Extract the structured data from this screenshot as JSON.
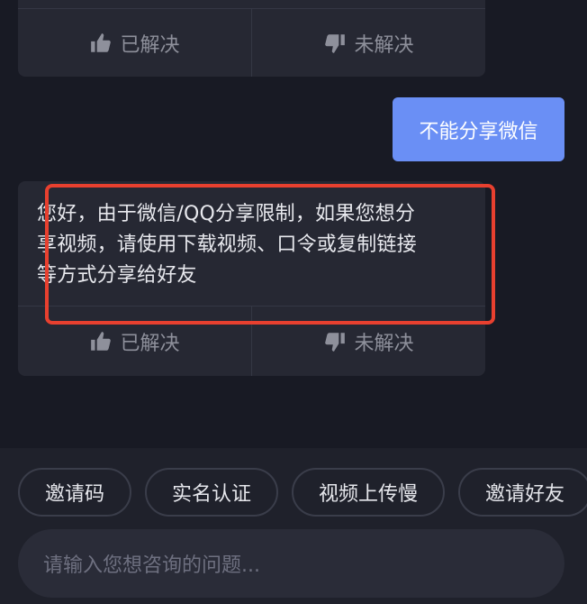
{
  "colors": {
    "background": "#181a24",
    "card": "#262833",
    "user_bubble": "#6a8ff5",
    "annotation": "#e8402f",
    "muted_text": "#8e909b"
  },
  "top_card": {
    "resolved_label": "已解决",
    "resolved_icon": "thumbs-up-icon",
    "unresolved_label": "未解决",
    "unresolved_icon": "thumbs-down-icon"
  },
  "user_message": {
    "text": "不能分享微信"
  },
  "bot_reply": {
    "line1": "您好，由于微信/QQ分享限制，如果您想分",
    "line2": "享视频，请使用下载视频、口令或复制链接",
    "line3": "等方式分享给好友",
    "resolved_label": "已解决",
    "unresolved_label": "未解决"
  },
  "quick_replies": [
    {
      "label": "邀请码"
    },
    {
      "label": "实名认证"
    },
    {
      "label": "视频上传慢"
    },
    {
      "label": "邀请好友"
    }
  ],
  "composer": {
    "placeholder": "请输入您想咨询的问题..."
  }
}
